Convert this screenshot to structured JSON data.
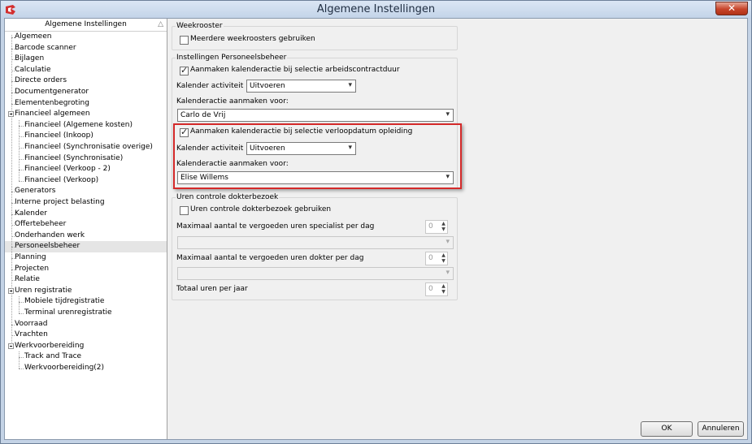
{
  "window": {
    "title": "Algemene Instellingen"
  },
  "tree": {
    "header": "Algemene Instellingen",
    "items": [
      {
        "label": "Algemeen",
        "level": 0,
        "expanded": false
      },
      {
        "label": "Barcode scanner",
        "level": 0
      },
      {
        "label": "Bijlagen",
        "level": 0
      },
      {
        "label": "Calculatie",
        "level": 0
      },
      {
        "label": "Directe orders",
        "level": 0
      },
      {
        "label": "Documentgenerator",
        "level": 0
      },
      {
        "label": "Elementenbegroting",
        "level": 0
      },
      {
        "label": "Financieel algemeen",
        "level": 0,
        "expandable": true
      },
      {
        "label": "Financieel (Algemene kosten)",
        "level": 1
      },
      {
        "label": "Financieel (Inkoop)",
        "level": 1
      },
      {
        "label": "Financieel (Synchronisatie overige)",
        "level": 1
      },
      {
        "label": "Financieel (Synchronisatie)",
        "level": 1
      },
      {
        "label": "Financieel (Verkoop - 2)",
        "level": 1
      },
      {
        "label": "Financieel (Verkoop)",
        "level": 1
      },
      {
        "label": "Generators",
        "level": 0
      },
      {
        "label": "Interne project belasting",
        "level": 0
      },
      {
        "label": "Kalender",
        "level": 0
      },
      {
        "label": "Offertebeheer",
        "level": 0
      },
      {
        "label": "Onderhanden werk",
        "level": 0
      },
      {
        "label": "Personeelsbeheer",
        "level": 0,
        "selected": true
      },
      {
        "label": "Planning",
        "level": 0
      },
      {
        "label": "Projecten",
        "level": 0
      },
      {
        "label": "Relatie",
        "level": 0
      },
      {
        "label": "Uren registratie",
        "level": 0,
        "expandable": true
      },
      {
        "label": "Mobiele tijdregistratie",
        "level": 1
      },
      {
        "label": "Terminal urenregistratie",
        "level": 1
      },
      {
        "label": "Voorraad",
        "level": 0
      },
      {
        "label": "Vrachten",
        "level": 0
      },
      {
        "label": "Werkvoorbereiding",
        "level": 0,
        "expandable": true
      },
      {
        "label": "Track and Trace",
        "level": 1
      },
      {
        "label": "Werkvoorbereiding(2)",
        "level": 1
      }
    ]
  },
  "weekrooster": {
    "legend": "Weekrooster",
    "multi_label": "Meerdere weekroosters gebruiken"
  },
  "personeel": {
    "legend": "Instellingen Personeelsbeheer",
    "contract_label": "Aanmaken kalenderactie bij selectie arbeidscontractduur",
    "activity_label": "Kalender activiteit",
    "activity_value": "Uitvoeren",
    "for_label": "Kalenderactie aanmaken voor:",
    "for_value": "Carlo de Vrij",
    "opleiding_label": "Aanmaken kalenderactie bij selectie verloopdatum opleiding",
    "activity2_label": "Kalender activiteit",
    "activity2_value": "Uitvoeren",
    "for2_label": "Kalenderactie aanmaken voor:",
    "for2_value": "Elise Willems"
  },
  "uren": {
    "legend": "Uren controle dokterbezoek",
    "use_label": "Uren controle dokterbezoek gebruiken",
    "spec_label": "Maximaal aantal te vergoeden uren specialist per dag",
    "spec_value": "0",
    "dokter_label": "Maximaal aantal te vergoeden uren dokter per dag",
    "dokter_value": "0",
    "totaal_label": "Totaal uren per jaar",
    "totaal_value": "0"
  },
  "buttons": {
    "ok": "OK",
    "cancel": "Annuleren"
  },
  "colors": {
    "highlight": "#d42a2a",
    "close": "#c7442b"
  }
}
